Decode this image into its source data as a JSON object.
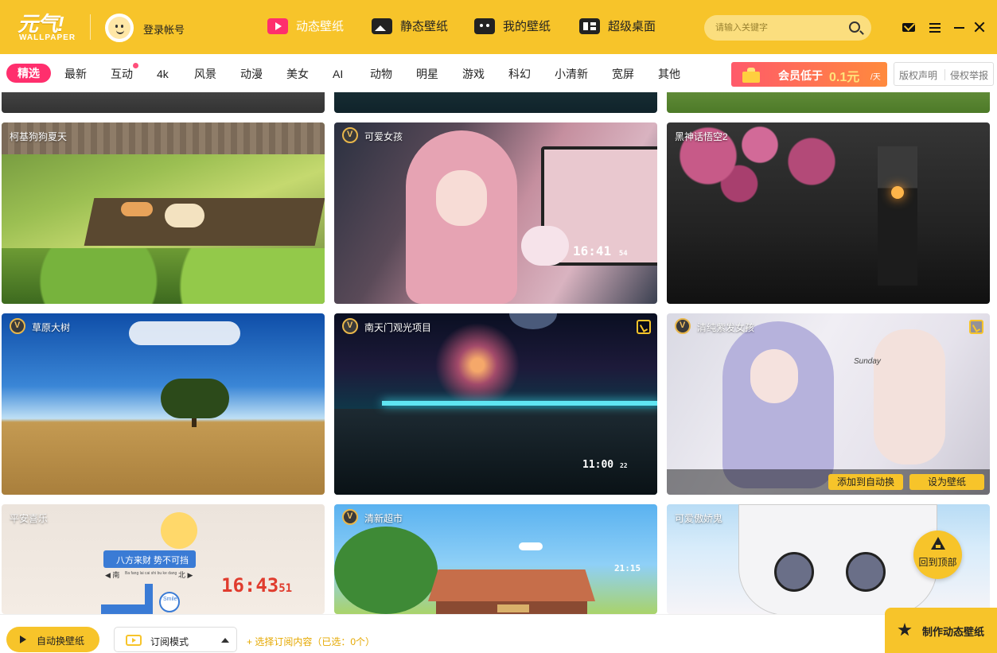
{
  "app": {
    "logo_main": "元气!",
    "logo_sub": "WALLPAPER",
    "login_label": "登录帐号"
  },
  "nav": [
    {
      "label": "动态壁纸",
      "icon": "play-video-icon",
      "active": true
    },
    {
      "label": "静态壁纸",
      "icon": "image-icon",
      "active": false
    },
    {
      "label": "我的壁纸",
      "icon": "my-wallpaper-icon",
      "active": false
    },
    {
      "label": "超级桌面",
      "icon": "desktop-icon",
      "active": false
    }
  ],
  "search": {
    "placeholder": "请输入关键字"
  },
  "categories": [
    "精选",
    "最新",
    "互动",
    "4k",
    "风景",
    "动漫",
    "美女",
    "AI",
    "动物",
    "明星",
    "游戏",
    "科幻",
    "小清新",
    "宽屏",
    "其他"
  ],
  "vip_promo": {
    "text": "会员低于",
    "price": "0.1元",
    "unit": "/天"
  },
  "links": {
    "copyright": "版权声明",
    "report": "侵权举报"
  },
  "tiles": [
    {
      "title": "柯基狗狗夏天",
      "vip": false
    },
    {
      "title": "可爱女孩",
      "vip": true,
      "clock": "16:41",
      "clock_sec": "54"
    },
    {
      "title": "黑神话悟空2",
      "vip": false
    },
    {
      "title": "草原大树",
      "vip": true
    },
    {
      "title": "南天门观光项目",
      "vip": true,
      "clock": "11:00",
      "clock_sec": "22"
    },
    {
      "title": "清纯紫发女孩",
      "vip": true,
      "overlay_text": "Sunday"
    },
    {
      "title": "平安喜乐",
      "vip": false,
      "banner": "八方来财 势不可挡",
      "banner_sub": "Ba fang lai cai shi bu ke dang",
      "south": "◀ 南",
      "north": "北 ▶",
      "clock": "16:43",
      "clock_sec": "51",
      "smile": "Smile"
    },
    {
      "title": "清新超市",
      "vip": true,
      "clock": "21:15"
    },
    {
      "title": "可爱傲娇鬼",
      "vip": false
    }
  ],
  "hover_actions": {
    "add_auto": "添加到自动换",
    "set_wallpaper": "设为壁纸"
  },
  "back_to_top": "回到顶部",
  "bottom": {
    "auto_switch": "自动换壁纸",
    "mode": "订阅模式",
    "choose": "+ 选择订阅内容（已选：0个）",
    "make_dynamic": "制作动态壁纸"
  },
  "colors": {
    "brand_yellow": "#f7c42a",
    "accent_pink": "#ff2f6d"
  }
}
